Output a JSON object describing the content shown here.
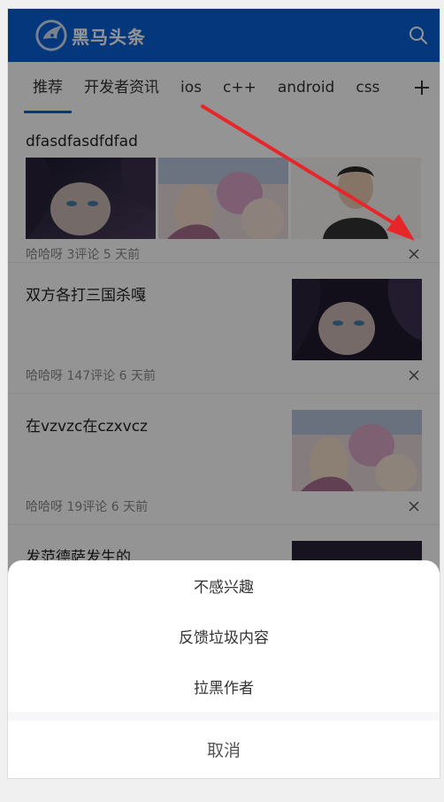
{
  "header": {
    "logo_text": "黑马头条",
    "brand_color": "#0a5fd6"
  },
  "tabs": {
    "items": [
      "推荐",
      "开发者资讯",
      "ios",
      "c++",
      "android",
      "css"
    ],
    "active_index": 0,
    "add_icon": "plus-icon"
  },
  "articles": [
    {
      "title": "dfasdfasdfdfad",
      "meta": "哈哈呀 3评论 5 天前"
    },
    {
      "title": "双方各打三国杀嘎",
      "meta": "哈哈呀 147评论 6 天前"
    },
    {
      "title": "在vzvzc在czxvcz",
      "meta": "哈哈呀 19评论 6 天前"
    },
    {
      "title": "发范德萨发生的",
      "meta": ""
    }
  ],
  "sheet": {
    "options": [
      "不感兴趣",
      "反馈垃圾内容",
      "拉黑作者"
    ],
    "cancel_label": "取消"
  },
  "colors": {
    "annotation_arrow": "#e8262a",
    "overlay": "rgba(0,0,0,0.42)"
  }
}
